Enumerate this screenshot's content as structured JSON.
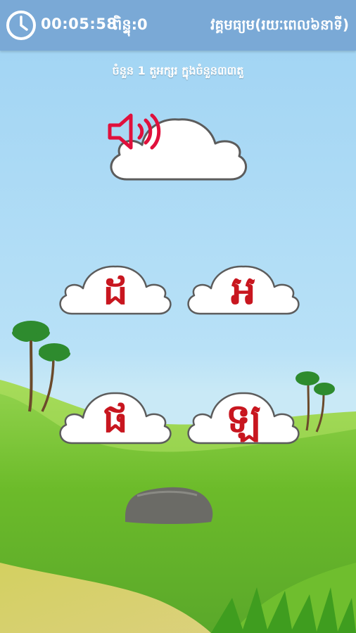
{
  "header": {
    "timer": "00:05:58",
    "score": "ពិន្ទុ:0",
    "level": "វគ្គមធ្យម(រយៈពេល៦នាទី)"
  },
  "instruction": "ចំនួន 1 តួអក្សរ ក្នុងចំនួន៣៣តួ",
  "answers": [
    {
      "letter": "ដ"
    },
    {
      "letter": "អ"
    },
    {
      "letter": "ផ"
    },
    {
      "letter": "ឡ"
    }
  ],
  "colors": {
    "topbar": "#7aa9d6",
    "letter": "#c8161f",
    "speaker": "#e0103c",
    "sky": "#a9d9f5",
    "grass": "#6cbb2a"
  },
  "icons": {
    "clock": "clock-icon",
    "speaker": "speaker-icon"
  }
}
